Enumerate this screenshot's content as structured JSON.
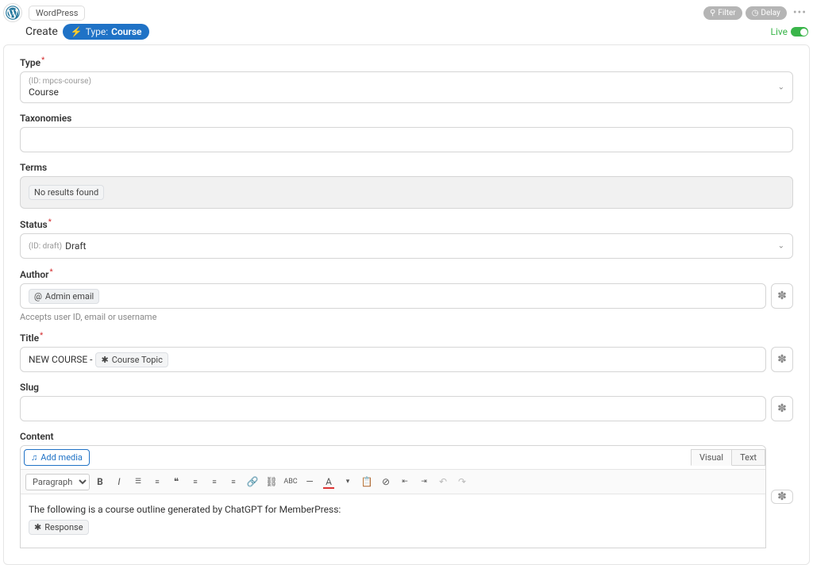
{
  "header": {
    "integration": "WordPress",
    "filter_btn": "Filter",
    "delay_btn": "Delay"
  },
  "subheader": {
    "create": "Create",
    "type_prefix": "Type:",
    "type_value": "Course",
    "live": "Live"
  },
  "fields": {
    "type": {
      "label": "Type",
      "id_hint": "(ID: mpcs-course)",
      "value": "Course"
    },
    "taxonomies": {
      "label": "Taxonomies"
    },
    "terms": {
      "label": "Terms",
      "empty": "No results found"
    },
    "status": {
      "label": "Status",
      "id_hint": "(ID: draft)",
      "value": "Draft"
    },
    "author": {
      "label": "Author",
      "chip": "Admin email",
      "helper": "Accepts user ID, email or username"
    },
    "title": {
      "label": "Title",
      "prefix": "NEW COURSE - ",
      "chip": "Course Topic"
    },
    "slug": {
      "label": "Slug"
    },
    "content": {
      "label": "Content",
      "add_media": "Add media",
      "tab_visual": "Visual",
      "tab_text": "Text",
      "format": "Paragraph",
      "body_text": "The following is a course outline generated by ChatGPT for MemberPress:",
      "response_chip": "Response"
    }
  }
}
